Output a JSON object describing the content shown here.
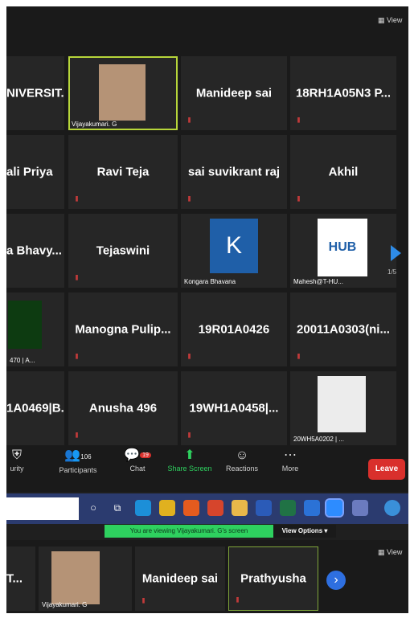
{
  "top_view_label": "View",
  "grid": {
    "row1": [
      {
        "name": "NIVERSIT..."
      },
      {
        "name": "Vijayakumari. G"
      },
      {
        "name": "Manideep sai"
      },
      {
        "name": "18RH1A05N3  P..."
      }
    ],
    "row2": [
      {
        "name": "ali Priya"
      },
      {
        "name": "Ravi Teja"
      },
      {
        "name": "sai suvikrant raj"
      },
      {
        "name": "Akhil"
      }
    ],
    "row3": [
      {
        "name": "a  Bhavy..."
      },
      {
        "name": "Tejaswini"
      },
      {
        "name": "Kongara Bhavana",
        "avatar_letter": "K"
      },
      {
        "name": "Mahesh@T-HU...",
        "logo_text": "HUB"
      }
    ],
    "row4": [
      {
        "name": "470 | A..."
      },
      {
        "name": "Manogna  Pulip..."
      },
      {
        "name": "19R01A0426"
      },
      {
        "name": "20011A0303(ni..."
      }
    ],
    "row5": [
      {
        "name": "1A0469|B..."
      },
      {
        "name": "Anusha 496"
      },
      {
        "name": "19WH1A0458|..."
      },
      {
        "name": "20WH5A0202 | ..."
      }
    ],
    "page_indicator": "1/5"
  },
  "toolbar": {
    "security": "urity",
    "participants": "Participants",
    "participants_count": "106",
    "chat": "Chat",
    "chat_badge": "19",
    "share": "Share Screen",
    "reactions": "Reactions",
    "more": "More",
    "leave": "Leave"
  },
  "banner": {
    "text": "You are viewing Vijayakumari. G's screen",
    "view_options": "View Options"
  },
  "bottom": {
    "view_label": "View",
    "tiles": [
      {
        "name": "T..."
      },
      {
        "name": "Vijayakumari. G"
      },
      {
        "name": "Manideep sai"
      },
      {
        "name": "Prathyusha"
      }
    ]
  },
  "colors": {
    "leave": "#d9302c",
    "share": "#2ed15f",
    "selection": "#b7d63a",
    "taskbar": "#2b3b6f"
  }
}
